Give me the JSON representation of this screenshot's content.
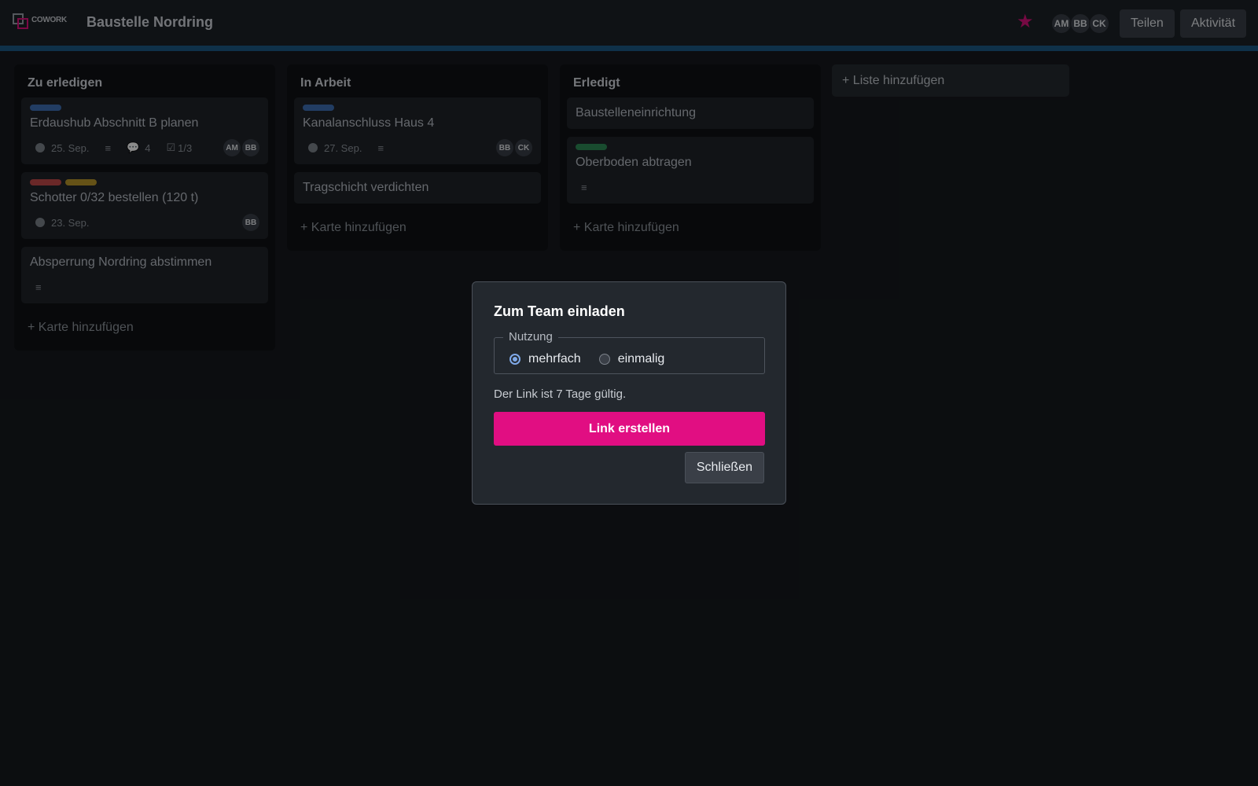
{
  "app": {
    "logo_text": "COWORK",
    "board_title": "Baustelle Nordring"
  },
  "header": {
    "members": [
      "AM",
      "BB",
      "CK"
    ],
    "share_label": "Teilen",
    "activity_label": "Aktivität",
    "favorite_icon": "star-icon",
    "accent": "#d8117a"
  },
  "lists": [
    {
      "title": "Zu erledigen",
      "cards": [
        {
          "labels": [
            "#3f6fb5"
          ],
          "title": "Erdaushub Abschnitt B planen",
          "due": "25. Sep.",
          "has_description": true,
          "comments": "4",
          "checklist": "1/3",
          "members": [
            "AM",
            "BB"
          ]
        },
        {
          "labels": [
            "#c24a4a",
            "#b9952a"
          ],
          "title": "Schotter 0/32 bestellen (120 t)",
          "due": "23. Sep.",
          "members": [
            "BB"
          ]
        },
        {
          "labels": [],
          "title": "Absperrung Nordring abstimmen",
          "has_description": true
        }
      ],
      "add_card_label": "+ Karte hinzufügen"
    },
    {
      "title": "In Arbeit",
      "cards": [
        {
          "labels": [
            "#3f6fb5"
          ],
          "title": "Kanalanschluss Haus 4",
          "due": "27. Sep.",
          "has_description": true,
          "members": [
            "BB",
            "CK"
          ]
        },
        {
          "labels": [],
          "title": "Tragschicht verdichten"
        }
      ],
      "add_card_label": "+ Karte hinzufügen"
    },
    {
      "title": "Erledigt",
      "cards": [
        {
          "labels": [],
          "title": "Baustelleneinrichtung"
        },
        {
          "labels": [
            "#2e8b57"
          ],
          "title": "Oberboden abtragen",
          "has_description": true
        }
      ],
      "add_card_label": "+ Karte hinzufügen"
    }
  ],
  "add_list_label": "+ Liste hinzufügen",
  "modal": {
    "title": "Zum Team einladen",
    "usage_legend": "Nutzung",
    "options": [
      {
        "label": "mehrfach",
        "selected": true
      },
      {
        "label": "einmalig",
        "selected": false
      }
    ],
    "hint": "Der Link ist 7 Tage gültig.",
    "primary_label": "Link erstellen",
    "close_label": "Schließen",
    "primary_color": "#e10e82"
  }
}
